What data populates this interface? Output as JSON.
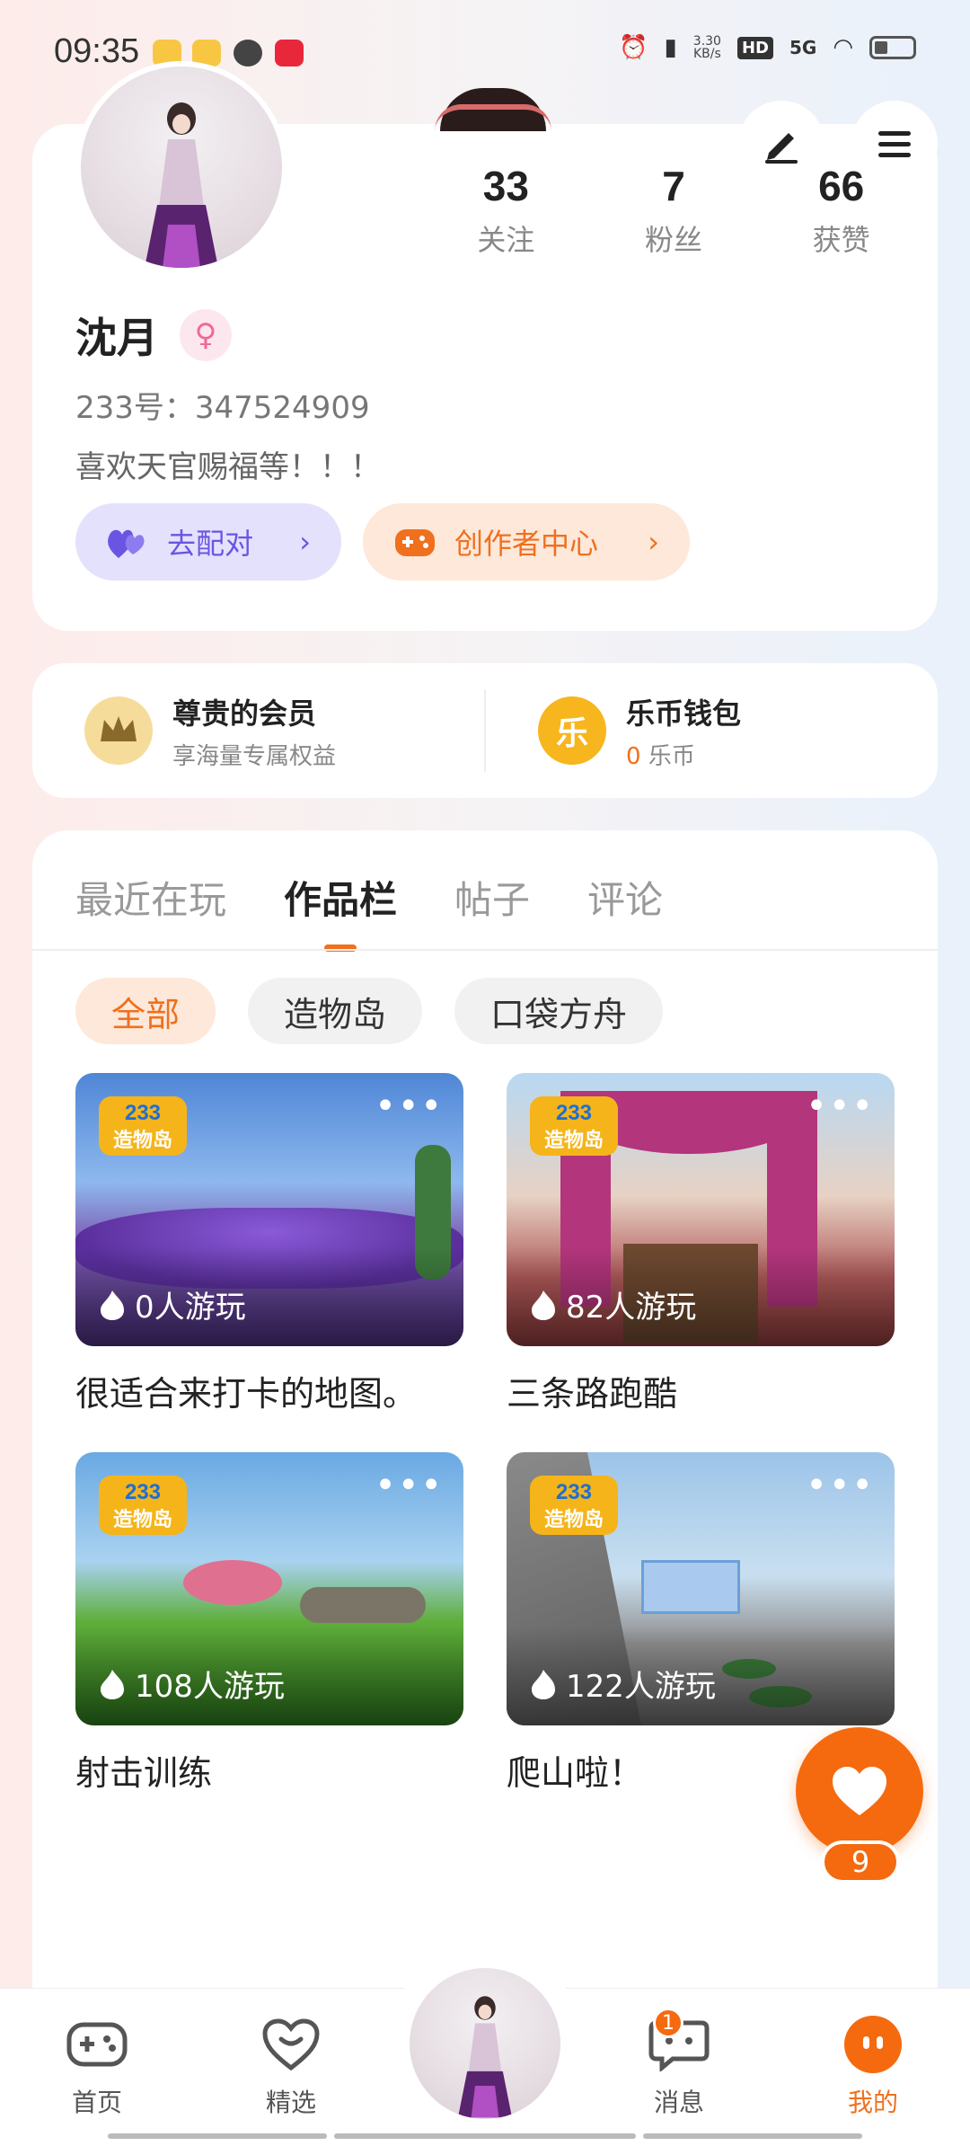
{
  "status_bar": {
    "time": "09:35",
    "net_speed": "3.30\nKB/s",
    "hd": "HD",
    "signal": "5G"
  },
  "profile": {
    "stats": [
      {
        "value": "33",
        "label": "关注"
      },
      {
        "value": "7",
        "label": "粉丝"
      },
      {
        "value": "66",
        "label": "获赞"
      }
    ],
    "name": "沈月",
    "gender_icon": "female-icon",
    "user_id": "233号：347524909",
    "bio": "喜欢天官赐福等！！！",
    "match_label": "去配对",
    "creator_label": "创作者中心"
  },
  "member": {
    "vip_title": "尊贵的会员",
    "vip_sub": "享海量专属权益",
    "wallet_title": "乐币钱包",
    "wallet_amount": "0",
    "wallet_unit": "乐币",
    "coin_glyph": "乐"
  },
  "tabs": [
    "最近在玩",
    "作品栏",
    "帖子",
    "评论"
  ],
  "filters": [
    "全部",
    "造物岛",
    "口袋方舟"
  ],
  "works": [
    {
      "title": "很适合来打卡的地图。",
      "plays": "0人游玩"
    },
    {
      "title": "三条路跑酷",
      "plays": "82人游玩"
    },
    {
      "title": "射击训练",
      "plays": "108人游玩"
    },
    {
      "title": "爬山啦！",
      "plays": "122人游玩"
    }
  ],
  "thumb_badge": {
    "line1": "233",
    "line2": "造物岛"
  },
  "more_glyph": "•••",
  "like": {
    "count": "9"
  },
  "nav": {
    "home": "首页",
    "featured": "精选",
    "messages": "消息",
    "messages_badge": "1",
    "mine": "我的"
  },
  "colors": {
    "accent": "#f0701e",
    "purple": "#6a55e3",
    "female": "#f06a96"
  }
}
